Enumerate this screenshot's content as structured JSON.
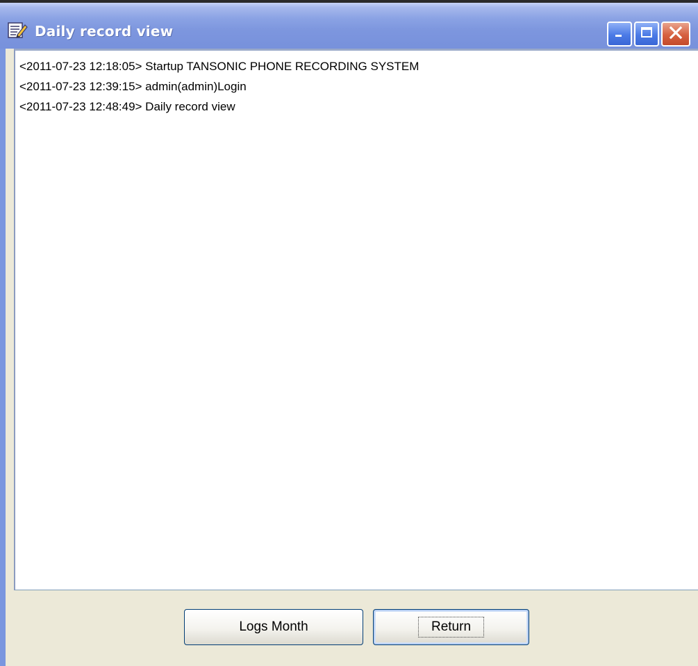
{
  "window": {
    "title": "Daily record view",
    "icon": "notepad-pencil-icon",
    "controls": {
      "minimize_icon": "minimize-icon",
      "maximize_icon": "maximize-icon",
      "close_icon": "close-icon"
    }
  },
  "log": {
    "lines": [
      "<2011-07-23 12:18:05> Startup TANSONIC PHONE RECORDING SYSTEM",
      "<2011-07-23 12:39:15> admin(admin)Login",
      "<2011-07-23 12:48:49> Daily record view"
    ]
  },
  "buttons": {
    "logs_month": "Logs Month",
    "return": "Return"
  },
  "colors": {
    "titlebar": "#7d96de",
    "close_button": "#d6603f",
    "dialog_background": "#ECE9D8"
  }
}
